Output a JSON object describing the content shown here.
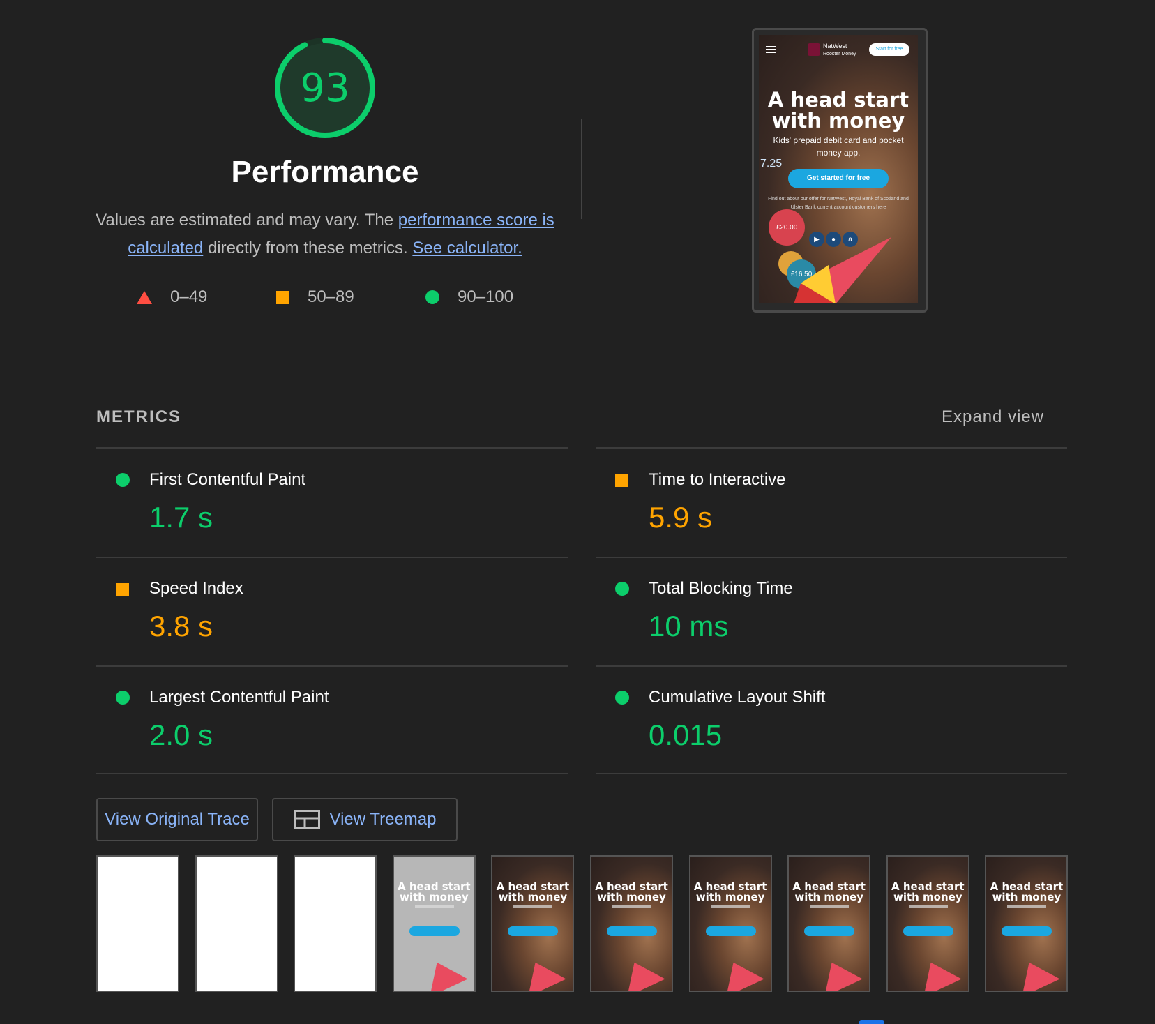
{
  "score": {
    "value": "93",
    "percent": 93,
    "color": "#0cce6b"
  },
  "category": {
    "title": "Performance"
  },
  "description": {
    "text1": "Values are estimated and may vary. The ",
    "link1": "performance score is calculated",
    "text2": " directly from these metrics. ",
    "link2": "See calculator."
  },
  "legend": [
    {
      "range": "0–49",
      "icon": "triangle-red",
      "color": "#ff4e42"
    },
    {
      "range": "50–89",
      "icon": "square-orange",
      "color": "#ffa400"
    },
    {
      "range": "90–100",
      "icon": "circle-green",
      "color": "#0cce6b"
    }
  ],
  "screenshot": {
    "brand_line1": "NatWest",
    "brand_line2": "Rooster Money",
    "start_button": "Start for free",
    "hero_title": "A head start with money",
    "hero_subtitle": "Kids' prepaid debit card and pocket money app.",
    "cta": "Get started for free",
    "fine_print": "Find out about our offer for NatWest, Royal Bank of Scotland and Ulster Bank current account customers here",
    "coin1": "£20.00",
    "coin2": "£16.50",
    "side_value": "7.25"
  },
  "metrics": {
    "label": "METRICS",
    "expand": "Expand view",
    "items": [
      {
        "name": "First Contentful Paint",
        "value": "1.7 s",
        "rating": "pass"
      },
      {
        "name": "Time to Interactive",
        "value": "5.9 s",
        "rating": "average"
      },
      {
        "name": "Speed Index",
        "value": "3.8 s",
        "rating": "average"
      },
      {
        "name": "Total Blocking Time",
        "value": "10 ms",
        "rating": "pass"
      },
      {
        "name": "Largest Contentful Paint",
        "value": "2.0 s",
        "rating": "pass"
      },
      {
        "name": "Cumulative Layout Shift",
        "value": "0.015",
        "rating": "pass"
      }
    ]
  },
  "buttons": {
    "trace": "View Original Trace",
    "treemap": "View Treemap"
  },
  "filmstrip": {
    "frame_title": "A head start with money",
    "frames": [
      "blank",
      "blank",
      "blank",
      "gray",
      "photo",
      "photo",
      "photo",
      "photo",
      "photo",
      "photo"
    ]
  }
}
